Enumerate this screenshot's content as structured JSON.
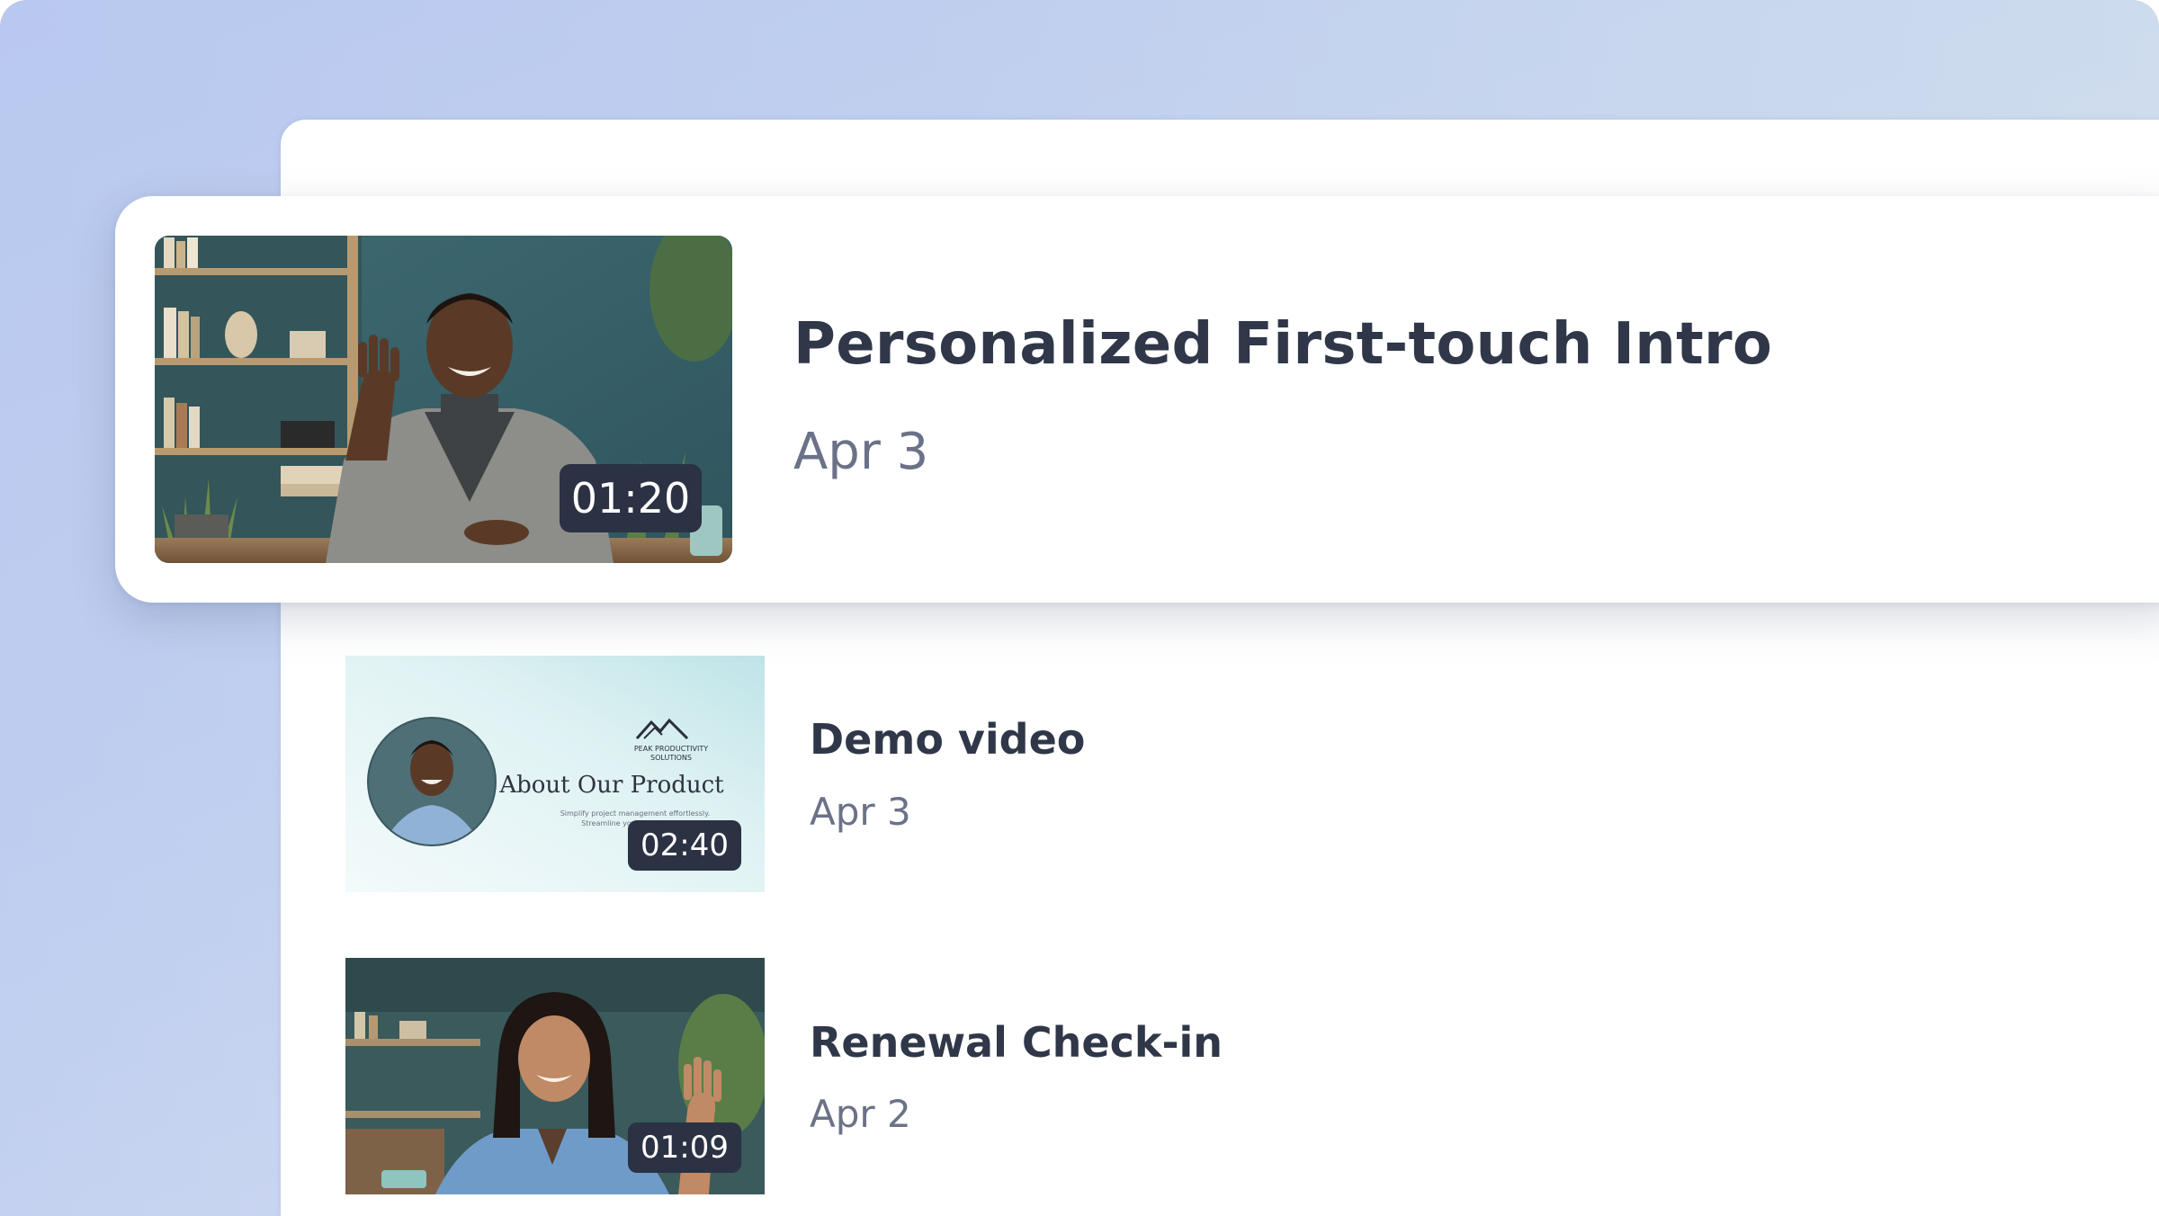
{
  "featured": {
    "title": "Personalized First-touch Intro",
    "date": "Apr 3",
    "duration": "01:20",
    "thumbnail_icon": "man-waving-at-desk-thumbnail"
  },
  "videos": [
    {
      "title": "Demo video",
      "date": "Apr 3",
      "duration": "02:40",
      "thumbnail": {
        "brand": "PEAK PRODUCTIVITY SOLUTIONS",
        "heading": "About Our Product",
        "subtext_line1": "Simplify project management effortlessly.",
        "subtext_line2": "Streamline yo"
      }
    },
    {
      "title": "Renewal Check-in",
      "date": "Apr 2",
      "duration": "01:09",
      "thumbnail_icon": "woman-waving-thumbnail"
    }
  ],
  "colors": {
    "title": "#2f3749",
    "date": "#6b7288",
    "badge": "#2b3244",
    "background": "#c4d2ee"
  }
}
